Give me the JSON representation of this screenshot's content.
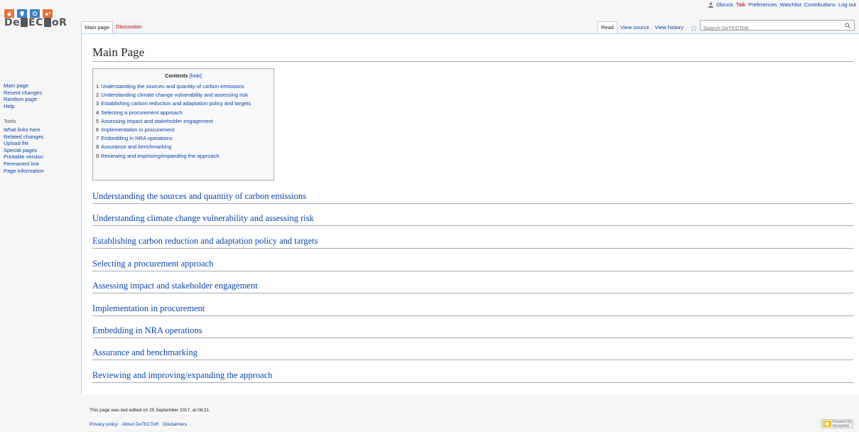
{
  "personal": {
    "username": "Dbruck",
    "talk": "Talk",
    "preferences": "Preferences",
    "watchlist": "Watchlist",
    "contributions": "Contributions",
    "logout": "Log out"
  },
  "logo": {
    "text_left": "De",
    "text_mid": "EC",
    "text_right": "oR"
  },
  "tabs": {
    "left": [
      {
        "label": "Main page",
        "selected": true
      },
      {
        "label": "Discussion",
        "selected": false
      }
    ],
    "right": [
      {
        "label": "Read",
        "selected": true
      },
      {
        "label": "View source",
        "selected": false
      },
      {
        "label": "View history",
        "selected": false
      }
    ]
  },
  "search": {
    "placeholder": "Search DeTECToR"
  },
  "sidebar": {
    "nav": [
      "Main page",
      "Recent changes",
      "Random page",
      "Help"
    ],
    "tools_heading": "Tools",
    "tools": [
      "What links here",
      "Related changes",
      "Upload file",
      "Special pages",
      "Printable version",
      "Permanent link",
      "Page information"
    ]
  },
  "page": {
    "title": "Main Page"
  },
  "toc": {
    "title": "Contents",
    "toggle": "[hide]",
    "items": [
      {
        "num": "1",
        "label": "Understanding the sources and quantity of carbon emissions"
      },
      {
        "num": "2",
        "label": "Understanding climate change vulnerability and assessing risk"
      },
      {
        "num": "3",
        "label": "Establishing carbon reduction and adaptation policy and targets"
      },
      {
        "num": "4",
        "label": "Selecting a procurement approach"
      },
      {
        "num": "5",
        "label": "Assessing impact and stakeholder engagement"
      },
      {
        "num": "6",
        "label": "Implementation in procurement"
      },
      {
        "num": "7",
        "label": "Embedding in NRA operations"
      },
      {
        "num": "8",
        "label": "Assurance and benchmarking"
      },
      {
        "num": "9",
        "label": "Reviewing and improving/expanding the approach"
      }
    ]
  },
  "sections": [
    "Understanding the sources and quantity of carbon emissions",
    "Understanding climate change vulnerability and assessing risk",
    "Establishing carbon reduction and adaptation policy and targets",
    "Selecting a procurement approach",
    "Assessing impact and stakeholder engagement",
    "Implementation in procurement",
    "Embedding in NRA operations",
    "Assurance and benchmarking",
    "Reviewing and improving/expanding the approach"
  ],
  "footer": {
    "last_modified": "This page was last edited on 25 September 2017, at 08:21.",
    "links": [
      "Privacy policy",
      "About DeTECToR",
      "Disclaimers"
    ],
    "powered_by": "Powered By MediaWiki"
  },
  "colors": {
    "link": "#0645ad",
    "new_link": "#ba0000",
    "logo_orange": "#e8723c",
    "logo_blue": "#3b7fc4"
  }
}
